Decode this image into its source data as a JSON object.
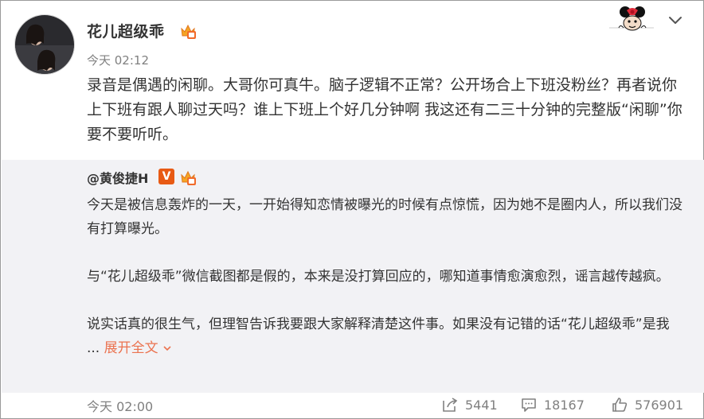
{
  "post": {
    "username": "花儿超级乖",
    "time": "今天 02:12",
    "text": "录音是偶遇的闲聊。大哥你可真牛。脑子逻辑不正常？公开场合上下班没粉丝？再者说你上下班有跟人聊过天吗？谁上下班上个好几分钟啊 我这还有二三十分钟的完整版“闲聊”你要不要听听。"
  },
  "repost": {
    "author": "@黄俊捷H",
    "verified_label": "V",
    "paragraphs": [
      "今天是被信息轰炸的一天，一开始得知恋情被曝光的时候有点惊慌，因为她不是圈内人，所以我们没有打算曝光。",
      "与“花儿超级乖”微信截图都是假的，本来是没打算回应的，哪知道事情愈演愈烈，谣言越传越疯。",
      "说实话真的很生气，但理智告诉我要跟大家解释清楚这件事。如果没有记错的话“花儿超级乖”是我 ..."
    ],
    "expand_label": "展开全文",
    "time": "今天 02:00",
    "shares": "5441",
    "comments": "18167",
    "likes": "576901"
  },
  "icons": {
    "badge": "crown-badge-icon",
    "menu": "chevron-down-icon",
    "share": "share-icon",
    "comment": "comment-icon",
    "like": "thumbs-up-icon"
  },
  "colors": {
    "link": "#eb7350",
    "repost_bg": "#f2f2f5",
    "verified": "#e85a14"
  }
}
